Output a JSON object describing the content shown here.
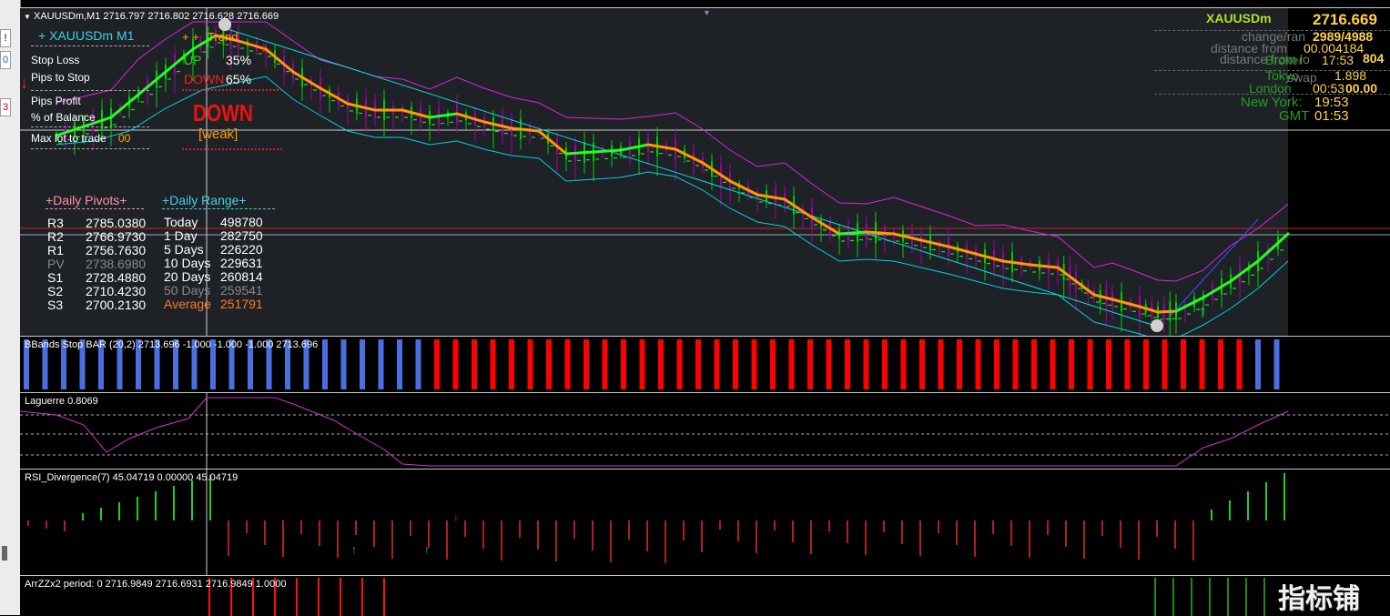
{
  "main": {
    "title": "XAUUSDm,M1",
    "ohlc": "2716.797 2716.802 2716.628 2716.669"
  },
  "info_panel": {
    "header": "+ XAUUSDm  M1",
    "arrows": "+ +",
    "trend_label": "Trend",
    "stop_loss": "Stop Loss",
    "pips_to_stop": "Pips to Stop",
    "pips_profit": "Pips Profit",
    "pct_balance": "% of Balance",
    "max_lot": "Max lot to trade",
    "max_lot_value": "00",
    "up_label": "UP",
    "up_pct": "35%",
    "down_label": "DOWN",
    "down_pct": "65%",
    "signal": "DOWN",
    "strength": "[weak]"
  },
  "pivots": {
    "header": "+Daily Pivots+",
    "rows": [
      {
        "name": "R3",
        "value": "2785.0380"
      },
      {
        "name": "R2",
        "value": "2766.9730"
      },
      {
        "name": "R1",
        "value": "2756.7630"
      },
      {
        "name": "PV",
        "value": "2738.6980"
      },
      {
        "name": "S1",
        "value": "2728.4880"
      },
      {
        "name": "S2",
        "value": "2710.4230"
      },
      {
        "name": "S3",
        "value": "2700.2130"
      }
    ]
  },
  "daily_range": {
    "header": "+Daily Range+",
    "rows": [
      {
        "label": "Today",
        "value": "498780"
      },
      {
        "label": "1 Day",
        "value": "282750"
      },
      {
        "label": "5 Days",
        "value": "226220"
      },
      {
        "label": "10 Days",
        "value": "229631"
      },
      {
        "label": "20 Days",
        "value": "260814"
      },
      {
        "label": "50 Days",
        "value": "259541"
      },
      {
        "label": "Average",
        "value": "251791"
      }
    ]
  },
  "right_panel": {
    "symbol": "XAUUSDm",
    "price": "2716.669",
    "change_label": "change/ran",
    "change_value": "2989/4988",
    "distance_high_label": "distance from",
    "distance_high_value": "00.004184",
    "distance_low_label": "distance from lo",
    "distance_low_value": "804",
    "broker_label": "Broker",
    "broker_time": "17:53",
    "tokyo_label": "Tokyo",
    "tokyo_time": "1.898",
    "swap_label": "swap",
    "swap_value": "00.00",
    "london_label": "London",
    "london_time": "00:53",
    "newyork_label": "New York:",
    "newyork_time": "19:53",
    "gmt_label": "GMT",
    "gmt_time": "01:53"
  },
  "subwindows": {
    "bbands": "BBands Stop BAR (20,2) 2713.696 -1.000 -1.000 -1.000 2713.696",
    "laguerre": "Laguerre 0.8069",
    "rsi": "RSI_Divergence(7) 45.04719 0.00000 45.04719",
    "zz": "ArrZZx2 period: 0 2716.9849 2716.6931 2716.9849 1.0000"
  },
  "left_toolbar": {
    "b1": "!",
    "b2": "0",
    "b3": "3"
  },
  "watermark": "指标铺",
  "colors": {
    "bull": "#00cc00",
    "bear": "#a000a0",
    "ma_orange": "#ff9900",
    "ma_green": "#22ff22",
    "envelope": "#e020e0",
    "channel": "#00ffff",
    "bb_blue": "#4a6fe0",
    "bb_red": "#ff0000"
  }
}
